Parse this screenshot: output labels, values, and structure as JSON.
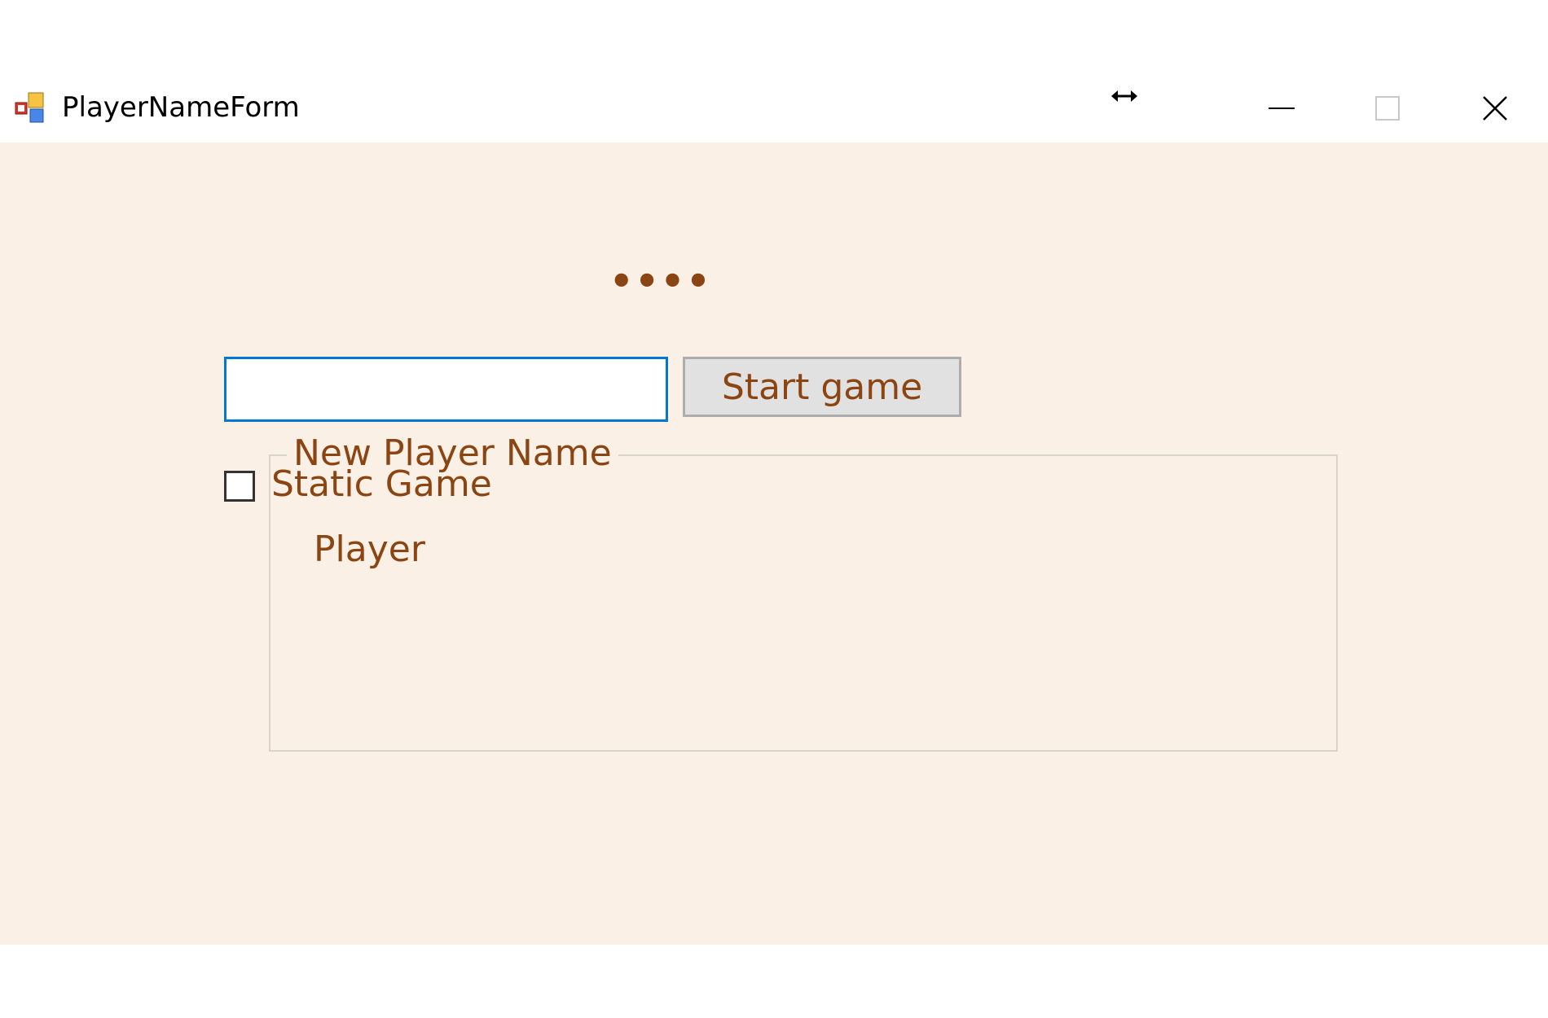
{
  "window": {
    "title": "PlayerNameForm",
    "icon": "winforms-app-icon",
    "controls": {
      "minimize": "minimize-icon",
      "maximize": "maximize-icon",
      "close": "close-icon"
    },
    "cursor": "horizontal-resize-cursor"
  },
  "form": {
    "status_dots": "••••",
    "group_title": "New Player Name",
    "player_label": "Player",
    "player_value": "",
    "start_button": "Start game",
    "static_game_label": "Static Game",
    "static_game_checked": false
  },
  "colors": {
    "background": "#faf0e6",
    "text": "#8b4513",
    "input_focus_border": "#0078d7",
    "button_face": "#e1e1e1"
  }
}
